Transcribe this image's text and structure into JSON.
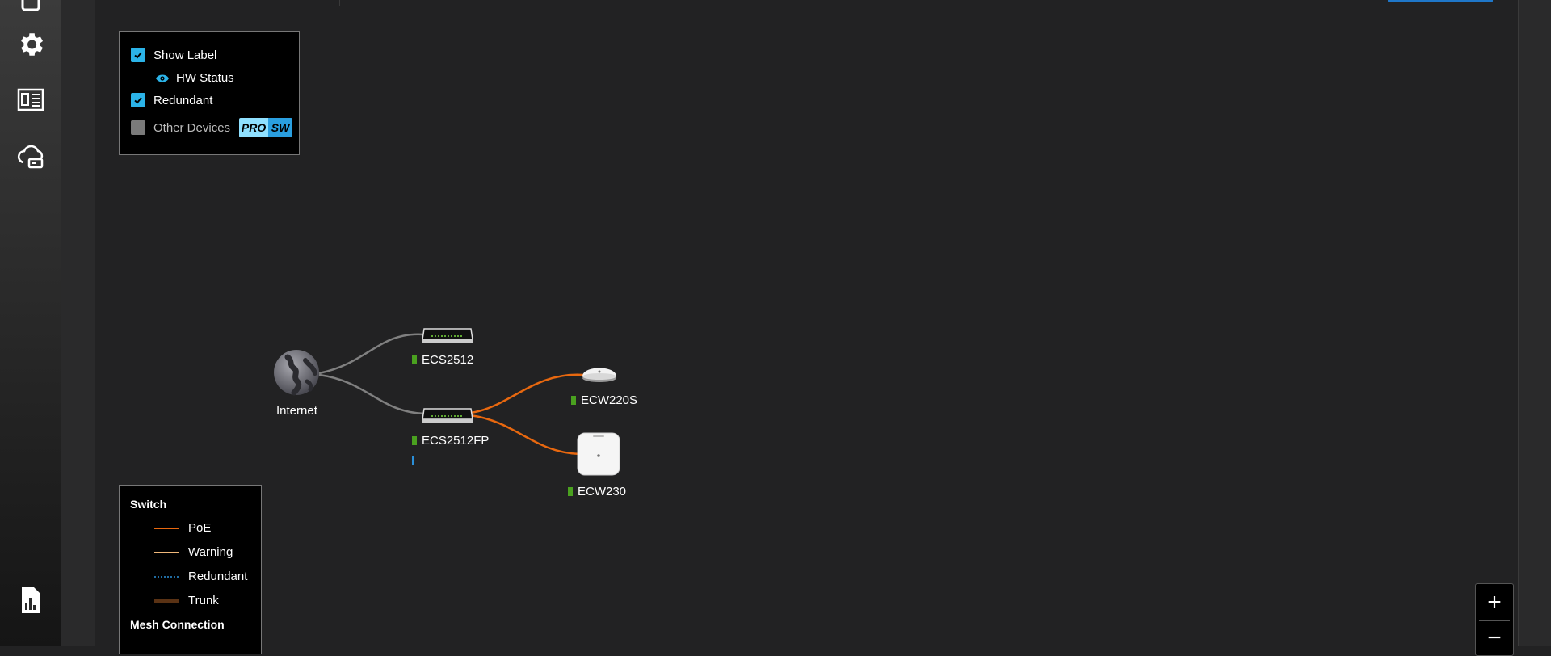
{
  "options": {
    "show_label": "Show Label",
    "hw_status": "HW Status",
    "redundant": "Redundant",
    "other_devices": "Other Devices",
    "badge_pro": "PRO",
    "badge_sw": "SW"
  },
  "legend": {
    "switch_title": "Switch",
    "poe": "PoE",
    "warning": "Warning",
    "redundant": "Redundant",
    "trunk": "Trunk",
    "mesh_title": "Mesh Connection"
  },
  "nodes": {
    "internet": "Internet",
    "switch1": "ECS2512",
    "switch2": "ECS2512FP",
    "ap1": "ECW220S",
    "ap2": "ECW230"
  },
  "colors": {
    "accent": "#2bb3e8",
    "poe_line": "#e8680f",
    "warning_line": "#f0b87a",
    "redundant_line": "#2a8fd8",
    "trunk_line": "#5a3214",
    "status_online": "#4aa11f",
    "uplink_line": "#808080"
  },
  "zoom": {
    "in": "+",
    "out": "−"
  }
}
